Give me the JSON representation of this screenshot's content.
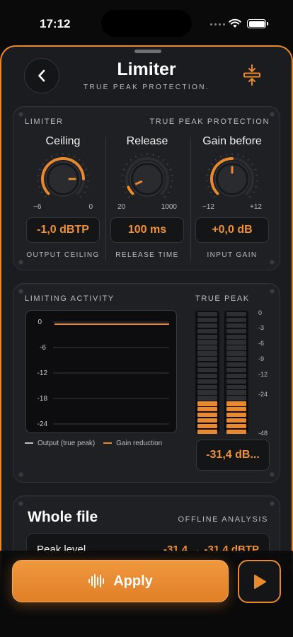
{
  "status_bar": {
    "time": "17:12"
  },
  "header": {
    "title": "Limiter",
    "subtitle": "TRUE PEAK PROTECTION."
  },
  "controls": {
    "caption_left": "LIMITER",
    "caption_right": "TRUE PEAK PROTECTION",
    "knobs": [
      {
        "title": "Ceiling",
        "min_label": "−6",
        "max_label": "0",
        "value": "-1,0 dBTP",
        "caption": "OUTPUT CEILING",
        "level": 0.83
      },
      {
        "title": "Release",
        "min_label": "20",
        "max_label": "1000",
        "value": "100 ms",
        "caption": "RELEASE TIME",
        "level": 0.08
      },
      {
        "title": "Gain before",
        "min_label": "−12",
        "max_label": "+12",
        "value": "+0,0 dB",
        "caption": "INPUT GAIN",
        "level": 0.5
      }
    ]
  },
  "activity": {
    "caption": "LIMITING ACTIVITY",
    "graph_labels": [
      "0",
      "-6",
      "-12",
      "-18",
      "-24"
    ],
    "legend_output": "Output (true peak)",
    "legend_gain": "Gain reduction",
    "true_peak_caption": "TRUE PEAK",
    "meter_scale": [
      "0",
      "-3",
      "-6",
      "-9",
      "-12",
      "-24",
      "-48"
    ],
    "meter_lit_segments": 6,
    "meter_total_segments": 22,
    "true_peak_readout": "-31,4 dB..."
  },
  "analysis": {
    "title": "Whole file",
    "caption": "OFFLINE ANALYSIS",
    "peak_label": "Peak level",
    "peak_value": "-31.4 → -31.4 dBTP"
  },
  "actions": {
    "apply_label": "Apply"
  },
  "colors": {
    "accent": "#e8892e",
    "accent_text": "#f0913a",
    "panel": "#1f2024"
  }
}
